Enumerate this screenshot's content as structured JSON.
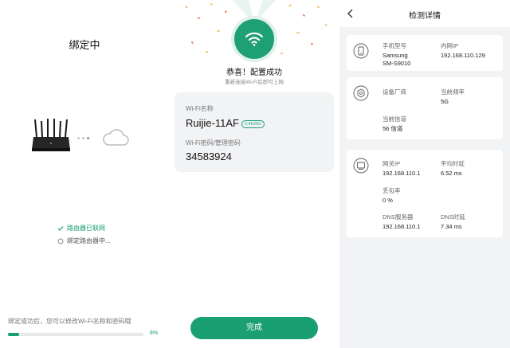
{
  "panel1": {
    "title": "绑定中",
    "steps": [
      {
        "label": "路由器已联网",
        "status": "done"
      },
      {
        "label": "绑定路由器中...",
        "status": "pending"
      }
    ],
    "tip": "绑定成功后，您可以修改Wi-Fi名称和密码哦",
    "progress_percent": 8,
    "progress_label": "8%"
  },
  "panel2": {
    "congrats": "恭喜！配置成功",
    "reconnect_hint": "重新连接Wi-Fi后即可上网",
    "wifi_name_label": "Wi-Fi名称",
    "wifi_name": "Ruijie-11AF",
    "band_tag": "2.4G/5G",
    "password_label": "Wi-Fi密码/管理密码",
    "password": "34583924",
    "done_button": "完成"
  },
  "panel3": {
    "title": "检测详情",
    "phone": {
      "model_label": "手机型号",
      "model_line1": "Samsung",
      "model_line2": "SM-S9010",
      "lan_ip_label": "内网IP",
      "lan_ip": "192.168.110.129"
    },
    "device": {
      "vendor_label": "设备厂商",
      "vendor": "",
      "freq_label": "当前频率",
      "freq": "5G",
      "channel_label": "当前信道",
      "channel": "56 信道"
    },
    "network": {
      "gateway_label": "网关IP",
      "gateway": "192.168.110.1",
      "avg_latency_label": "平均时延",
      "avg_latency": "6.52 ms",
      "loss_label": "丢包率",
      "loss": "0 %",
      "dns_label": "DNS服务器",
      "dns": "192.168.110.1",
      "dns_latency_label": "DNS时延",
      "dns_latency": "7.34 ms"
    }
  },
  "colors": {
    "accent": "#1a9f73",
    "page_bg": "#ffffff",
    "panel3_bg": "#f2f3f5"
  }
}
